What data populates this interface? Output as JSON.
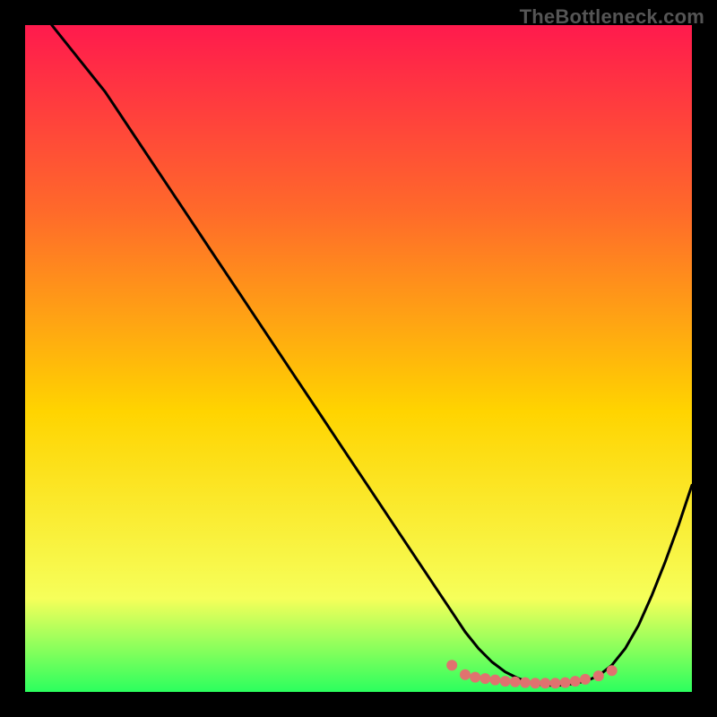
{
  "watermark": "TheBottleneck.com",
  "colors": {
    "gradient_top": "#ff1a4d",
    "gradient_mid1": "#ff6a2a",
    "gradient_mid2": "#ffd400",
    "gradient_mid3": "#f6ff5a",
    "gradient_bottom": "#2bff5e",
    "curve": "#000000",
    "markers": "#e0726f",
    "frame": "#000000"
  },
  "chart_data": {
    "type": "line",
    "title": "",
    "xlabel": "",
    "ylabel": "",
    "xlim": [
      0,
      100
    ],
    "ylim": [
      0,
      100
    ],
    "series": [
      {
        "name": "bottleneck-curve",
        "x": [
          4,
          8,
          12,
          16,
          20,
          24,
          28,
          32,
          36,
          40,
          44,
          48,
          52,
          56,
          60,
          62,
          64,
          66,
          68,
          70,
          72,
          74,
          76,
          78,
          80,
          82,
          84,
          86,
          88,
          90,
          92,
          94,
          96,
          98,
          100
        ],
        "y": [
          100,
          95,
          90,
          84,
          78,
          72,
          66,
          60,
          54,
          48,
          42,
          36,
          30,
          24,
          18,
          15,
          12,
          9,
          6.5,
          4.5,
          3,
          2,
          1.3,
          1,
          1,
          1.2,
          1.6,
          2.4,
          4,
          6.5,
          10,
          14.5,
          19.5,
          25,
          31
        ]
      }
    ],
    "markers": {
      "name": "optimal-points",
      "x": [
        64,
        66,
        67.5,
        69,
        70.5,
        72,
        73.5,
        75,
        76.5,
        78,
        79.5,
        81,
        82.5,
        84,
        86,
        88
      ],
      "y": [
        4,
        2.6,
        2.2,
        2,
        1.8,
        1.6,
        1.5,
        1.4,
        1.3,
        1.3,
        1.3,
        1.4,
        1.6,
        1.9,
        2.4,
        3.2
      ]
    }
  }
}
